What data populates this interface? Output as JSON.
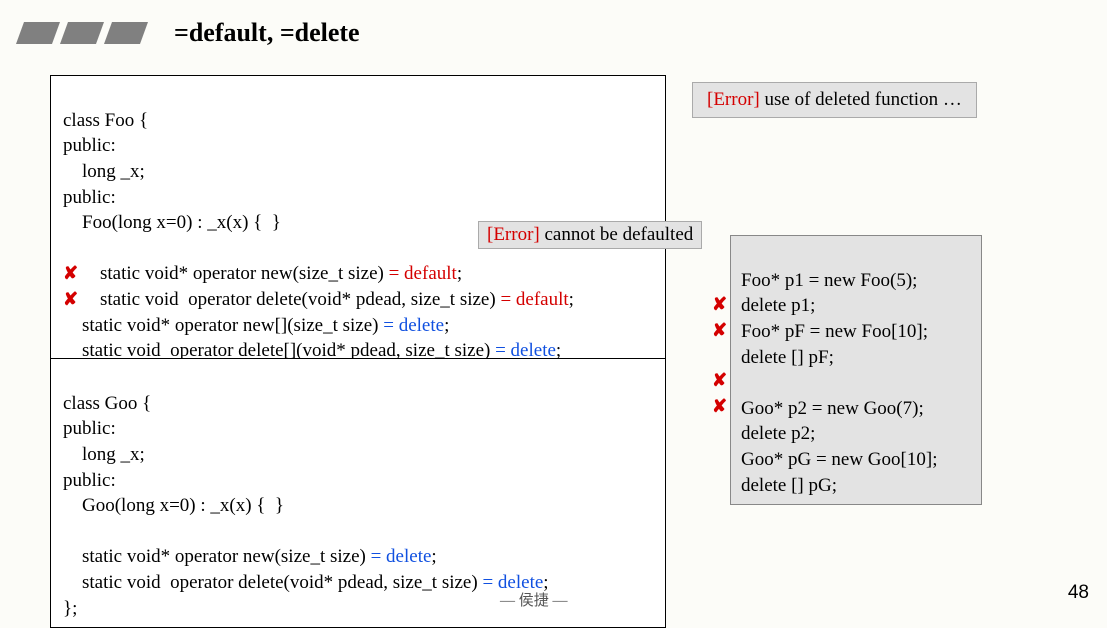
{
  "header": {
    "title": "=default, =delete"
  },
  "foo": {
    "l1": "class Foo {",
    "l2": "public:",
    "l3": "    long _x;",
    "l4": "public:",
    "l5": "    Foo(long x=0) : _x(x) {  }",
    "l6": "",
    "l7a": "    static void* operator new(size_t size) ",
    "l7b": "= default",
    "l7c": ";",
    "l8a": "    static void  operator delete(void* pdead, size_t size) ",
    "l8b": "= default",
    "l8c": ";",
    "l9a": "    static void* operator new[](size_t size) ",
    "l9b": "= delete",
    "l9c": ";",
    "l10a": "    static void  operator delete[](void* pdead, size_t size) ",
    "l10b": "= delete",
    "l10c": ";",
    "l11": "};"
  },
  "goo": {
    "l1": "class Goo {",
    "l2": "public:",
    "l3": "    long _x;",
    "l4": "public:",
    "l5": "    Goo(long x=0) : _x(x) {  }",
    "l6": "",
    "l7a": "    static void* operator new(size_t size) ",
    "l7b": "= delete",
    "l7c": ";",
    "l8a": "    static void  operator delete(void* pdead, size_t size) ",
    "l8b": "= delete",
    "l8c": ";",
    "l9": "};"
  },
  "usage": {
    "l1": "Foo* p1 = new Foo(5);",
    "l2": "delete p1;",
    "l3": "Foo* pF = new Foo[10];",
    "l4": "delete [] pF;",
    "l5": "",
    "l6": "Goo* p2 = new Goo(7);",
    "l7": "delete p2;",
    "l8": "Goo* pG = new Goo[10];",
    "l9": "delete [] pG;"
  },
  "callout1": {
    "err": "[Error]",
    "txt": " cannot be defaulted"
  },
  "callout2": {
    "err": "[Error]",
    "txt": " use of deleted function …"
  },
  "footer": "— 侯捷 —",
  "slidenum": "48",
  "x": "✘"
}
